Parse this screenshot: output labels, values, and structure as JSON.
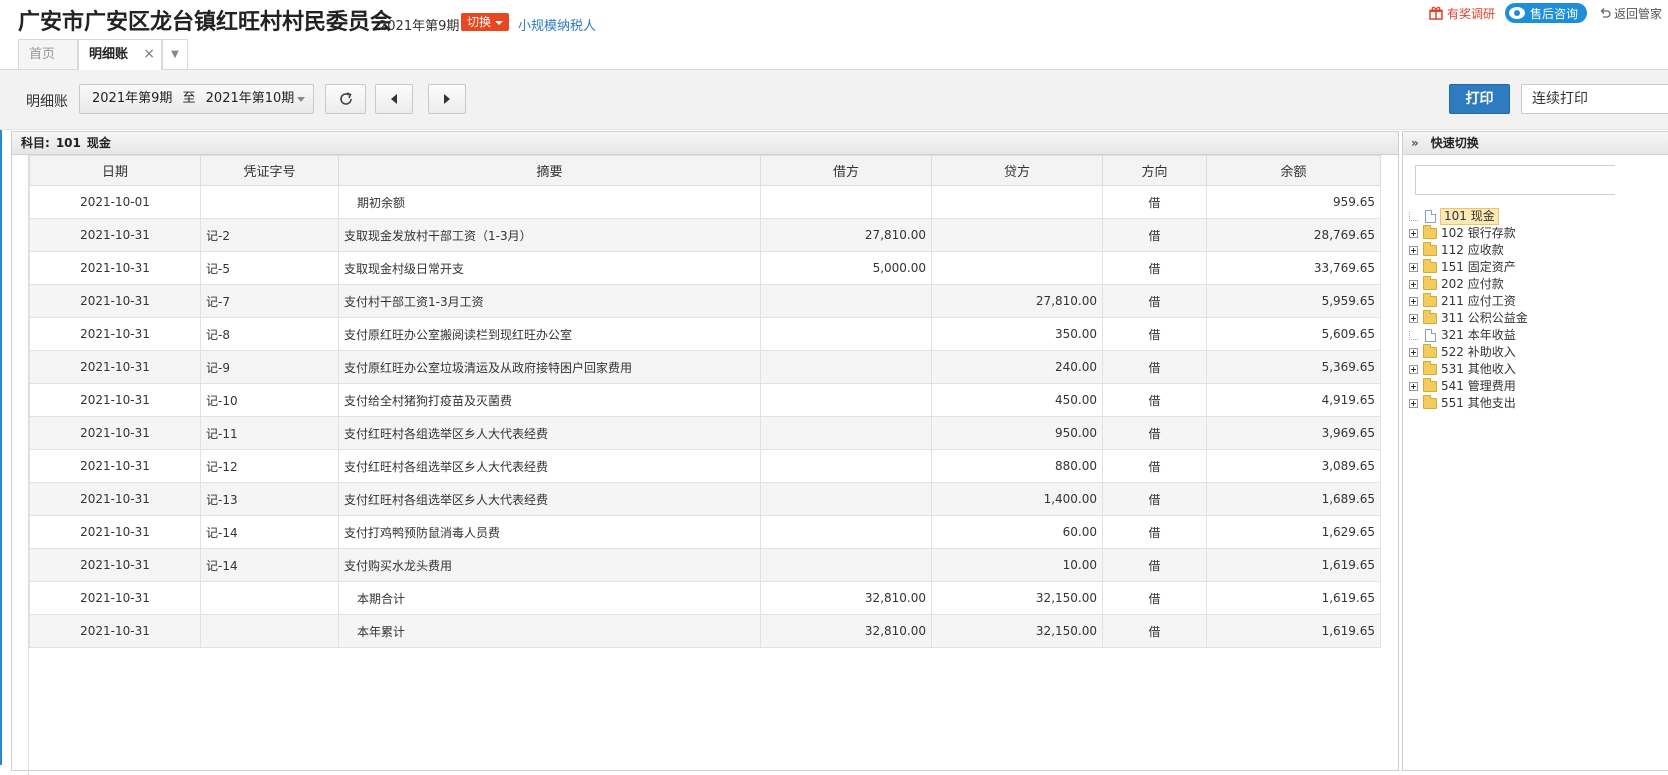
{
  "header": {
    "company": "广安市广安区龙台镇红旺村村民委员会",
    "period": "2021年第9期",
    "switch_label": "切换",
    "taxpayer": "小规模纳税人",
    "reward_label": "有奖调研",
    "consult_label": "售后咨询",
    "back_label": "返回管家"
  },
  "tabs": {
    "home": "首页",
    "active": "明细账",
    "close": "×"
  },
  "toolbar": {
    "label": "明细账",
    "range_start": "2021年第9期",
    "range_to": "至",
    "range_end": "2021年第10期",
    "print_label": "打印",
    "cont_print_label": "连续打印"
  },
  "subject": {
    "prefix": "科目:",
    "code": "101",
    "name": "现金"
  },
  "grid": {
    "columns": [
      "日期",
      "凭证字号",
      "摘要",
      "借方",
      "贷方",
      "方向",
      "余额"
    ],
    "rows": [
      {
        "date": "2021-10-01",
        "voucher": "",
        "summary": "期初余额",
        "debit": "",
        "credit": "",
        "dir": "借",
        "balance": "959.65"
      },
      {
        "date": "2021-10-31",
        "voucher": "记-2",
        "summary": "支取现金发放村干部工资（1-3月）",
        "debit": "27,810.00",
        "credit": "",
        "dir": "借",
        "balance": "28,769.65"
      },
      {
        "date": "2021-10-31",
        "voucher": "记-5",
        "summary": "支取现金村级日常开支",
        "debit": "5,000.00",
        "credit": "",
        "dir": "借",
        "balance": "33,769.65"
      },
      {
        "date": "2021-10-31",
        "voucher": "记-7",
        "summary": "支付村干部工资1-3月工资",
        "debit": "",
        "credit": "27,810.00",
        "dir": "借",
        "balance": "5,959.65"
      },
      {
        "date": "2021-10-31",
        "voucher": "记-8",
        "summary": "支付原红旺办公室搬阅读栏到现红旺办公室",
        "debit": "",
        "credit": "350.00",
        "dir": "借",
        "balance": "5,609.65"
      },
      {
        "date": "2021-10-31",
        "voucher": "记-9",
        "summary": "支付原红旺办公室垃圾清运及从政府接特困户回家费用",
        "debit": "",
        "credit": "240.00",
        "dir": "借",
        "balance": "5,369.65"
      },
      {
        "date": "2021-10-31",
        "voucher": "记-10",
        "summary": "支付给全村猪狗打疫苗及灭菌费",
        "debit": "",
        "credit": "450.00",
        "dir": "借",
        "balance": "4,919.65"
      },
      {
        "date": "2021-10-31",
        "voucher": "记-11",
        "summary": "支付红旺村各组选举区乡人大代表经费",
        "debit": "",
        "credit": "950.00",
        "dir": "借",
        "balance": "3,969.65"
      },
      {
        "date": "2021-10-31",
        "voucher": "记-12",
        "summary": "支付红旺村各组选举区乡人大代表经费",
        "debit": "",
        "credit": "880.00",
        "dir": "借",
        "balance": "3,089.65"
      },
      {
        "date": "2021-10-31",
        "voucher": "记-13",
        "summary": "支付红旺村各组选举区乡人大代表经费",
        "debit": "",
        "credit": "1,400.00",
        "dir": "借",
        "balance": "1,689.65"
      },
      {
        "date": "2021-10-31",
        "voucher": "记-14",
        "summary": "支付打鸡鸭预防鼠消毒人员费",
        "debit": "",
        "credit": "60.00",
        "dir": "借",
        "balance": "1,629.65"
      },
      {
        "date": "2021-10-31",
        "voucher": "记-14",
        "summary": "支付购买水龙头费用",
        "debit": "",
        "credit": "10.00",
        "dir": "借",
        "balance": "1,619.65"
      },
      {
        "date": "2021-10-31",
        "voucher": "",
        "summary": "本期合计",
        "debit": "32,810.00",
        "credit": "32,150.00",
        "dir": "借",
        "balance": "1,619.65"
      },
      {
        "date": "2021-10-31",
        "voucher": "",
        "summary": "本年累计",
        "debit": "32,810.00",
        "credit": "32,150.00",
        "dir": "借",
        "balance": "1,619.65"
      }
    ]
  },
  "side": {
    "title": "快速切换",
    "tree": [
      {
        "code": "101",
        "name": "现金",
        "type": "leaf",
        "selected": true
      },
      {
        "code": "102",
        "name": "银行存款",
        "type": "folder"
      },
      {
        "code": "112",
        "name": "应收款",
        "type": "folder"
      },
      {
        "code": "151",
        "name": "固定资产",
        "type": "folder"
      },
      {
        "code": "202",
        "name": "应付款",
        "type": "folder"
      },
      {
        "code": "211",
        "name": "应付工资",
        "type": "folder"
      },
      {
        "code": "311",
        "name": "公积公益金",
        "type": "folder"
      },
      {
        "code": "321",
        "name": "本年收益",
        "type": "leaf"
      },
      {
        "code": "522",
        "name": "补助收入",
        "type": "folder"
      },
      {
        "code": "531",
        "name": "其他收入",
        "type": "folder"
      },
      {
        "code": "541",
        "name": "管理费用",
        "type": "folder"
      },
      {
        "code": "551",
        "name": "其他支出",
        "type": "folder"
      }
    ]
  }
}
